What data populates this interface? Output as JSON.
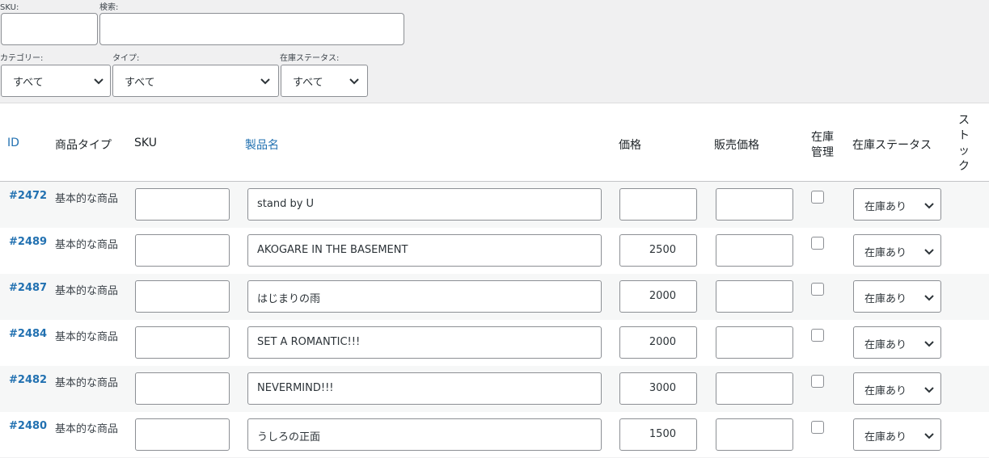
{
  "filters": {
    "sku_label": "SKU:",
    "search_label": "検索:",
    "category_label": "カテゴリー:",
    "category_value": "すべて",
    "type_label": "タイプ:",
    "type_value": "すべて",
    "stock_status_label": "在庫ステータス:",
    "stock_status_value": "すべて"
  },
  "table": {
    "headers": {
      "id": "ID",
      "product_type": "商品タイプ",
      "sku": "SKU",
      "name": "製品名",
      "price": "価格",
      "sale_price": "販売価格",
      "manage_stock_1": "在庫",
      "manage_stock_2": "管理",
      "stock_status": "在庫ステータス",
      "stock_1": "ス",
      "stock_2": "ト",
      "stock_3": "ッ",
      "stock_4": "ク"
    },
    "rows": [
      {
        "id": "#2472",
        "type": "基本的な商品",
        "sku": "",
        "name": "stand by U",
        "price": "",
        "sale": "",
        "stock_status": "在庫あり"
      },
      {
        "id": "#2489",
        "type": "基本的な商品",
        "sku": "",
        "name": "AKOGARE IN THE BASEMENT",
        "price": "2500",
        "sale": "",
        "stock_status": "在庫あり"
      },
      {
        "id": "#2487",
        "type": "基本的な商品",
        "sku": "",
        "name": "はじまりの雨",
        "price": "2000",
        "sale": "",
        "stock_status": "在庫あり"
      },
      {
        "id": "#2484",
        "type": "基本的な商品",
        "sku": "",
        "name": "SET A ROMANTIC!!!",
        "price": "2000",
        "sale": "",
        "stock_status": "在庫あり"
      },
      {
        "id": "#2482",
        "type": "基本的な商品",
        "sku": "",
        "name": "NEVERMIND!!!",
        "price": "3000",
        "sale": "",
        "stock_status": "在庫あり"
      },
      {
        "id": "#2480",
        "type": "基本的な商品",
        "sku": "",
        "name": "うしろの正面",
        "price": "1500",
        "sale": "",
        "stock_status": "在庫あり"
      }
    ]
  },
  "colors": {
    "link": "#2271b1",
    "border": "#8c8f94",
    "background": "#f0f0f1"
  },
  "icons": {
    "select_arrow": "chevron-down-icon"
  }
}
